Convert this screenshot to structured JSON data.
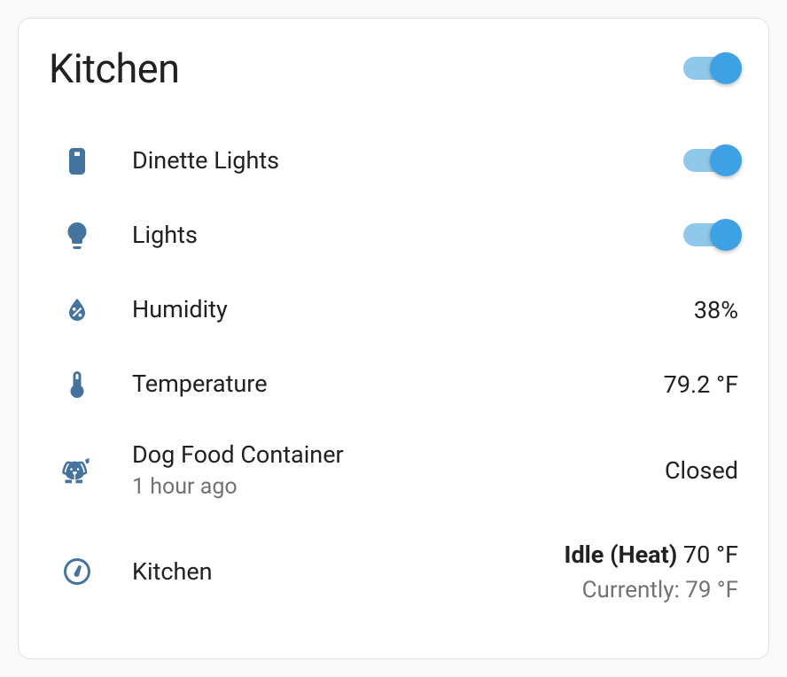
{
  "card": {
    "title": "Kitchen",
    "master_toggle_on": true
  },
  "entities": [
    {
      "icon": "switch",
      "name": "Dinette Lights",
      "type": "toggle",
      "on": true
    },
    {
      "icon": "lightbulb",
      "name": "Lights",
      "type": "toggle",
      "on": true
    },
    {
      "icon": "humidity",
      "name": "Humidity",
      "type": "sensor",
      "value": "38%"
    },
    {
      "icon": "thermometer",
      "name": "Temperature",
      "type": "sensor",
      "value": "79.2 °F"
    },
    {
      "icon": "dog",
      "name": "Dog Food Container",
      "secondary": "1 hour ago",
      "type": "sensor",
      "value": "Closed"
    },
    {
      "icon": "gauge",
      "name": "Kitchen",
      "type": "thermostat",
      "state": "Idle (Heat)",
      "target": "70 °F",
      "current": "Currently: 79 °F"
    }
  ]
}
